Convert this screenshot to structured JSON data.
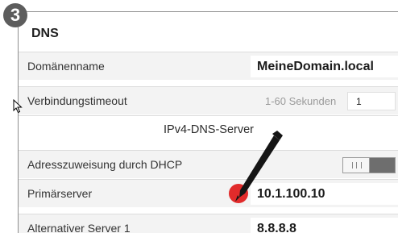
{
  "step_number": "3",
  "section": {
    "title": "DNS",
    "domain_name": {
      "label": "Domänenname",
      "value": "MeineDomain.local"
    },
    "connection_timeout": {
      "label": "Verbindungstimeout",
      "hint": "1-60 Sekunden",
      "value": "1"
    },
    "ipv4_dns_heading": "IPv4-DNS-Server",
    "dhcp_assignment": {
      "label": "Adresszuweisung durch DHCP",
      "toggle_glyph": "III",
      "state": "off"
    },
    "primary_server": {
      "label": "Primärserver",
      "value": "10.1.100.10"
    },
    "alternative_server_1": {
      "label": "Alternativer Server 1",
      "value": "8.8.8.8"
    }
  },
  "colors": {
    "badge": "#5d5d5d",
    "row_gray": "#f3f3f3",
    "toggle_dark": "#6e6e6e",
    "marker_red": "#e12b2b"
  }
}
